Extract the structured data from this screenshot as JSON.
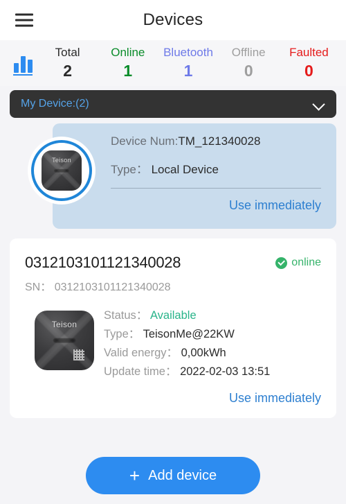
{
  "header": {
    "title": "Devices",
    "menu_icon": "hamburger-menu-icon"
  },
  "stats": {
    "chart_icon": "bar-chart-icon",
    "items": [
      {
        "label": "Total",
        "value": "2",
        "color": "#2b2b2b"
      },
      {
        "label": "Online",
        "value": "1",
        "color": "#0a8c2a"
      },
      {
        "label": "Bluetooth",
        "value": "1",
        "color": "#6e7ae8"
      },
      {
        "label": "Offline",
        "value": "0",
        "color": "#9e9e9e"
      },
      {
        "label": "Faulted",
        "value": "0",
        "color": "#e51b1b"
      }
    ]
  },
  "group_selector": {
    "label": "My Device:(2)",
    "chevron_icon": "chevron-down-icon"
  },
  "local_device": {
    "device_num_label": "Device Num:",
    "device_num_value": "TM_121340028",
    "type_label": "Type：",
    "type_value": "Local Device",
    "action_label": "Use immediately",
    "avatar_icon": "teison-charger-icon"
  },
  "device_card": {
    "title": "0312103101121340028",
    "status_badge": {
      "icon": "check-circle-icon",
      "text": "online",
      "color": "#35b36a"
    },
    "sn_label": "SN：",
    "sn_value": "0312103101121340028",
    "device_image": "teison-charger-icon",
    "rows": [
      {
        "label": "Status：",
        "value": "Available",
        "highlight": true
      },
      {
        "label": "Type：",
        "value": "TeisonMe@22KW",
        "highlight": false
      },
      {
        "label": "Valid energy：",
        "value": "0,00kWh",
        "highlight": false
      },
      {
        "label": "Update time：",
        "value": "2022-02-03 13:51",
        "highlight": false
      }
    ],
    "action_label": "Use immediately"
  },
  "add_button": {
    "icon": "plus-icon",
    "label": "Add device",
    "color": "#2d8cf0"
  },
  "device_brand_text": "Teison"
}
